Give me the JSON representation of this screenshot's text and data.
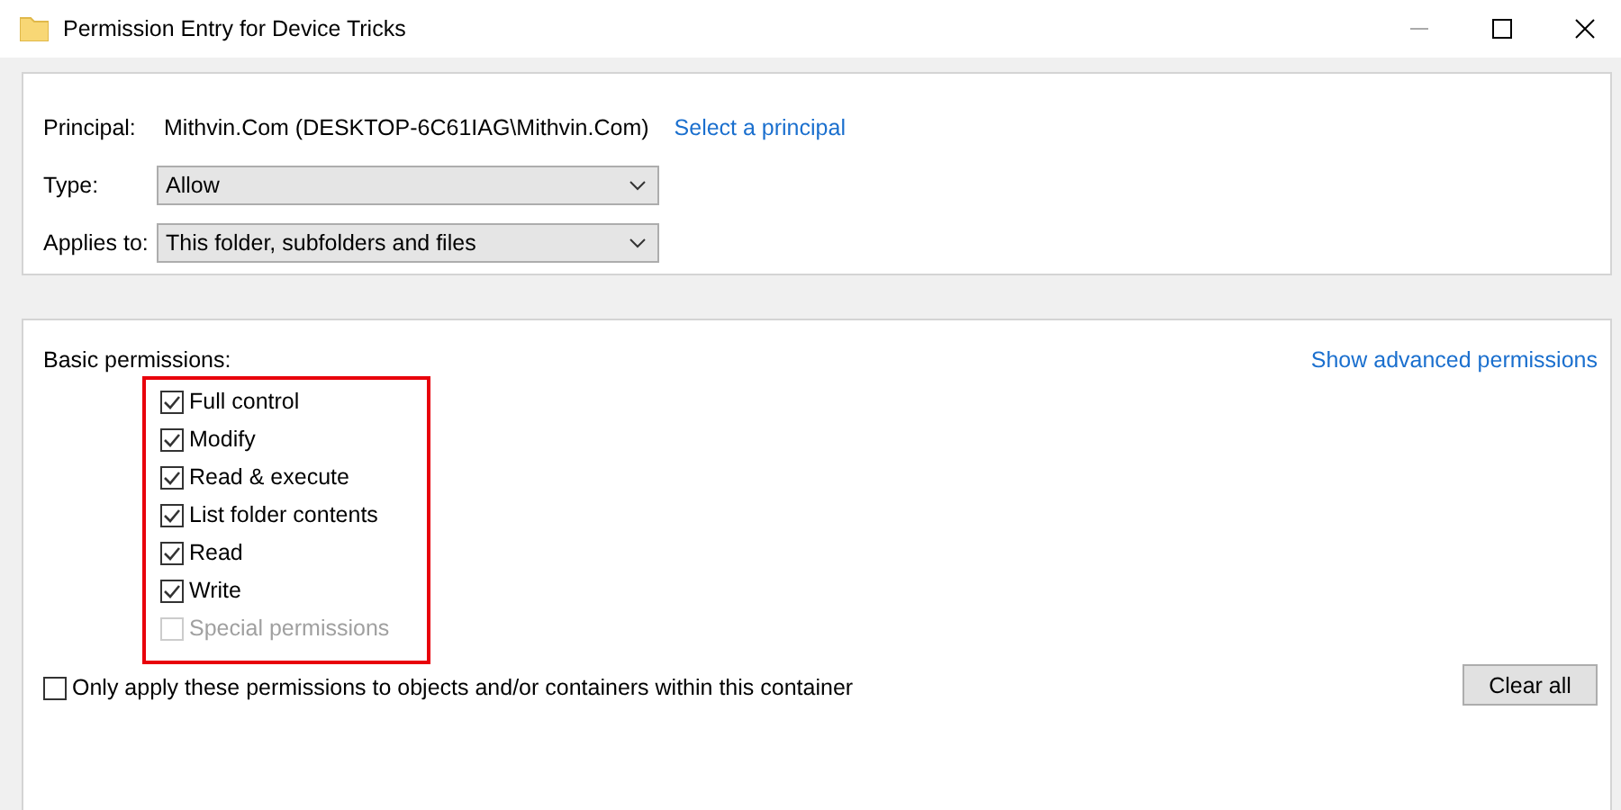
{
  "window": {
    "title": "Permission Entry for Device Tricks"
  },
  "principal": {
    "label": "Principal:",
    "value": "Mithvin.Com (DESKTOP-6C61IAG\\Mithvin.Com)",
    "link": "Select a principal"
  },
  "fields": [
    {
      "label": "Type:",
      "value": "Allow"
    },
    {
      "label": "Applies to:",
      "value": "This folder, subfolders and files"
    }
  ],
  "basic_permissions": {
    "label": "Basic permissions:",
    "link": "Show advanced permissions",
    "items": [
      {
        "label": "Full control",
        "checked": true,
        "disabled": false
      },
      {
        "label": "Modify",
        "checked": true,
        "disabled": false
      },
      {
        "label": "Read & execute",
        "checked": true,
        "disabled": false
      },
      {
        "label": "List folder contents",
        "checked": true,
        "disabled": false
      },
      {
        "label": "Read",
        "checked": true,
        "disabled": false
      },
      {
        "label": "Write",
        "checked": true,
        "disabled": false
      },
      {
        "label": "Special permissions",
        "checked": false,
        "disabled": true
      }
    ]
  },
  "only_apply": {
    "label": "Only apply these permissions to objects and/or containers within this container",
    "checked": false
  },
  "buttons": [
    "Clear all"
  ]
}
